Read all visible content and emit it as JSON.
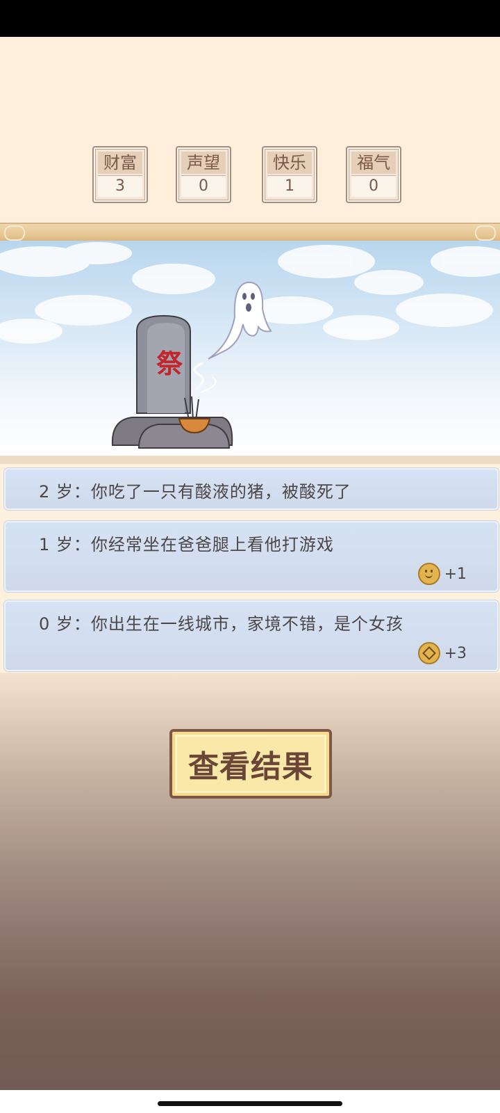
{
  "stats": [
    {
      "label": "财富",
      "value": "3"
    },
    {
      "label": "声望",
      "value": "0"
    },
    {
      "label": "快乐",
      "value": "1"
    },
    {
      "label": "福气",
      "value": "0"
    }
  ],
  "scene": {
    "tombstone_text": "祭"
  },
  "events": [
    {
      "text": "2 岁：你吃了一只有酸液的猪，被酸死了"
    },
    {
      "text": "1 岁：你经常坐在爸爸腿上看他打游戏",
      "reward_icon": "smile-coin-icon",
      "reward": "+1"
    },
    {
      "text": "0 岁：你出生在一线城市，家境不错，是个女孩",
      "reward_icon": "diamond-coin-icon",
      "reward": "+3"
    }
  ],
  "button": {
    "label": "查看结果"
  },
  "colors": {
    "accent": "#7d5849",
    "button_bg": "#f9e8a8",
    "event_bg": "#d6e3f4",
    "tomb_text": "#c0262c"
  }
}
